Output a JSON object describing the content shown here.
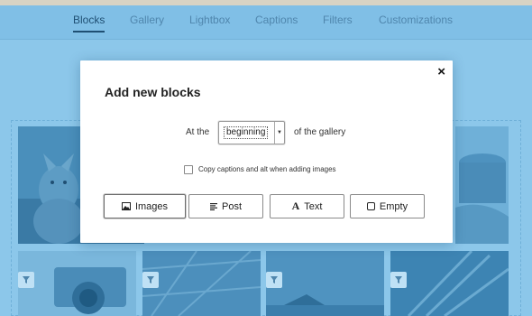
{
  "tabs": [
    {
      "label": "Blocks",
      "active": true
    },
    {
      "label": "Gallery",
      "active": false
    },
    {
      "label": "Lightbox",
      "active": false
    },
    {
      "label": "Captions",
      "active": false
    },
    {
      "label": "Filters",
      "active": false
    },
    {
      "label": "Customizations",
      "active": false
    }
  ],
  "modal": {
    "title": "Add new blocks",
    "close_icon": "×",
    "position_prefix": "At the",
    "position_value": "beginning",
    "position_suffix": "of the gallery",
    "checkbox_label": "Copy captions and alt when adding images",
    "checkbox_checked": false,
    "buttons": [
      {
        "label": "Images",
        "icon": "image-icon"
      },
      {
        "label": "Post",
        "icon": "post-lines-icon"
      },
      {
        "label": "Text",
        "icon": "text-A-icon"
      },
      {
        "label": "Empty",
        "icon": "empty-square-icon"
      }
    ]
  },
  "colors": {
    "background": "#8cc7ea",
    "tabbar": "#80bfe6",
    "active_tab": "#1f4f73",
    "tab_text": "#4f86ad",
    "thumb_tint": "#3d87b6"
  }
}
